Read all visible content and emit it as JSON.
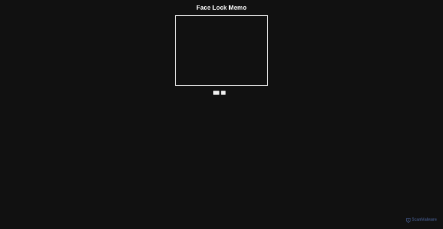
{
  "app": {
    "title": "Face Lock Memo"
  },
  "controls": {
    "buttons": [
      {
        "label": ""
      },
      {
        "label": ""
      }
    ]
  },
  "watermark": {
    "text": "ScanMalware",
    "icon": "scanmalware-logo-icon",
    "color": "#4f6aa6"
  },
  "colors": {
    "background": "#111111",
    "title": "#ffffff",
    "frame_border": "#e6e6e6"
  }
}
